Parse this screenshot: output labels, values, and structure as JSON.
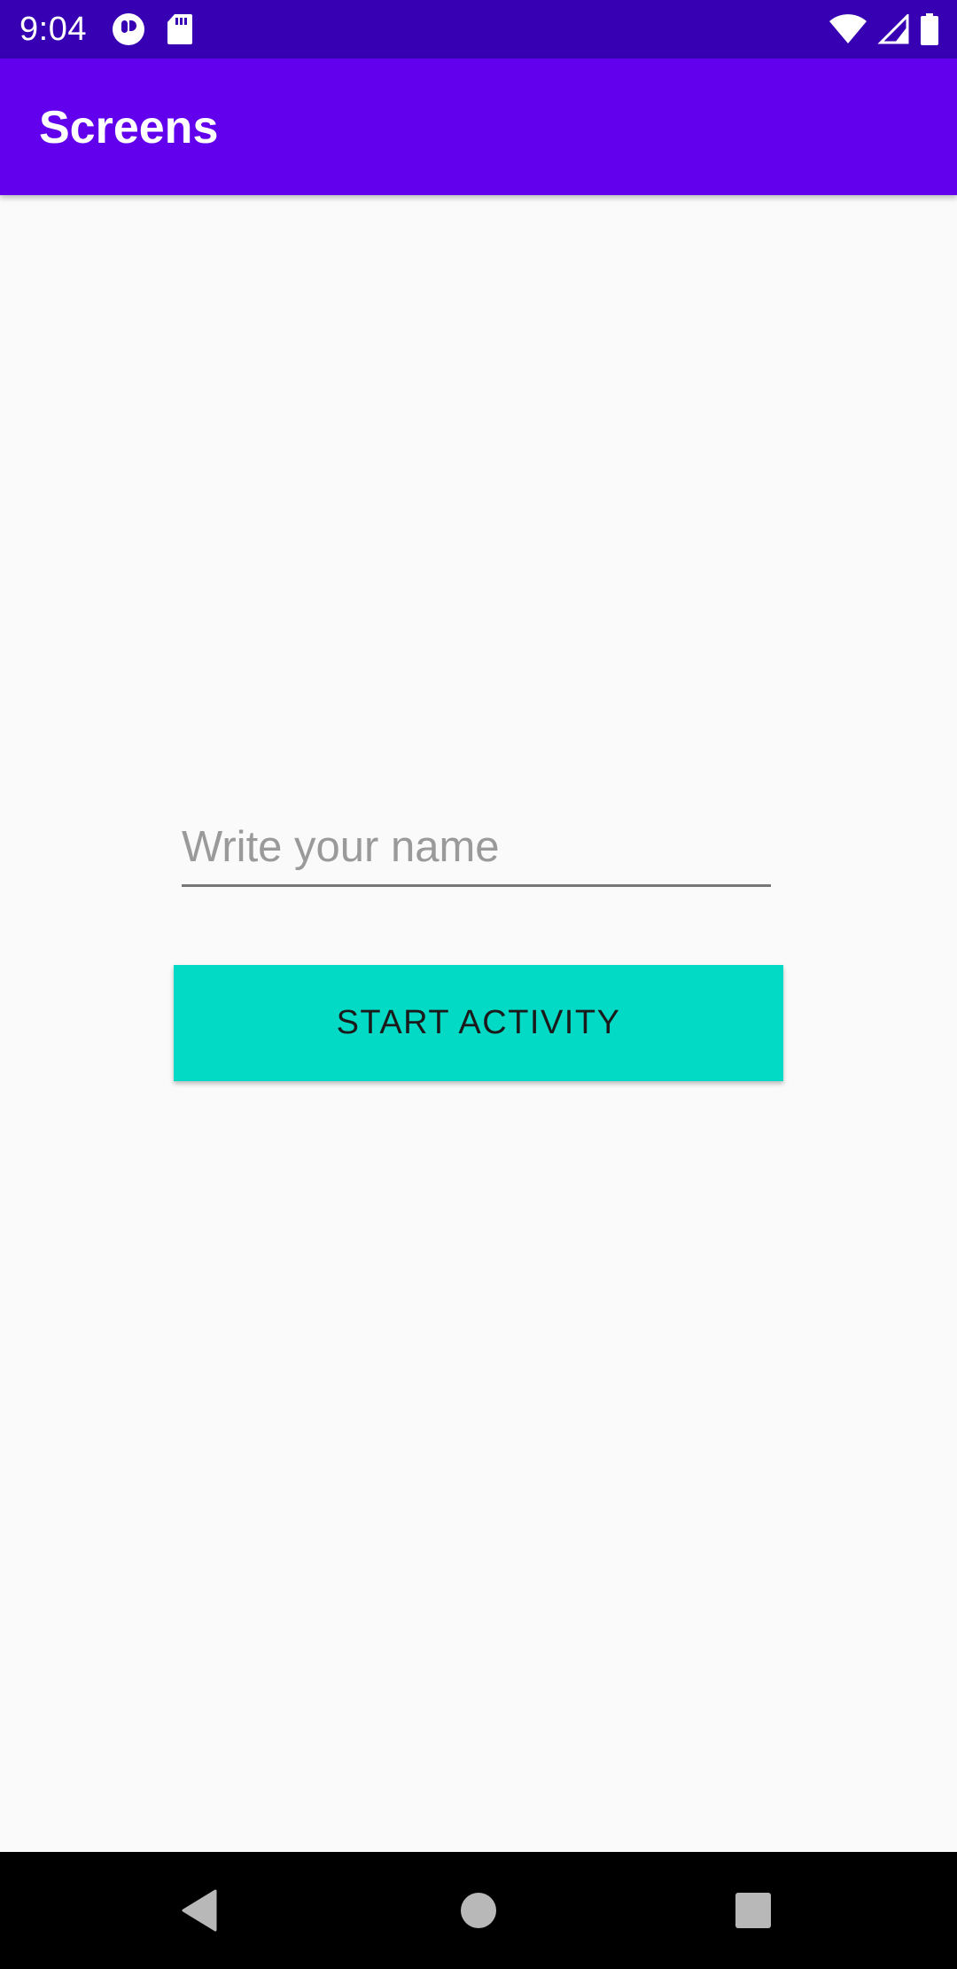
{
  "status_bar": {
    "time": "9:04",
    "left_icons": [
      "notification-app-icon",
      "sd-card-icon"
    ],
    "right_icons": [
      "wifi-icon",
      "cell-signal-icon",
      "battery-icon"
    ],
    "background_color": "#3700b3"
  },
  "app_bar": {
    "title": "Screens",
    "background_color": "#6200ee"
  },
  "form": {
    "name_input": {
      "value": "",
      "placeholder": "Write your name"
    },
    "start_button": {
      "label": "START ACTIVITY",
      "color": "#03dac5"
    }
  },
  "nav_bar": {
    "buttons": [
      "back-icon",
      "home-icon",
      "recents-icon"
    ]
  }
}
